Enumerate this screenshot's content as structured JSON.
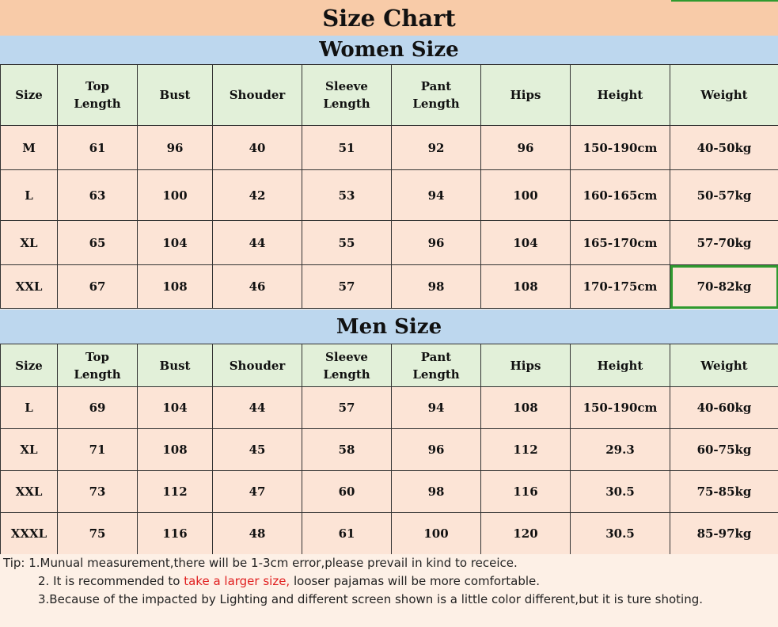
{
  "title": "Size Chart",
  "women": {
    "heading": "Women Size",
    "headers": [
      "Size",
      "Top\nLength",
      "Bust",
      "Shouder",
      "Sleeve\nLength",
      "Pant\nLength",
      "Hips",
      "Height",
      "Weight"
    ],
    "rows": [
      [
        "M",
        "61",
        "96",
        "40",
        "51",
        "92",
        "96",
        "150-190cm",
        "40-50kg"
      ],
      [
        "L",
        "63",
        "100",
        "42",
        "53",
        "94",
        "100",
        "160-165cm",
        "50-57kg"
      ],
      [
        "XL",
        "65",
        "104",
        "44",
        "55",
        "96",
        "104",
        "165-170cm",
        "57-70kg"
      ],
      [
        "XXL",
        "67",
        "108",
        "46",
        "57",
        "98",
        "108",
        "170-175cm",
        "70-82kg"
      ]
    ]
  },
  "men": {
    "heading": "Men Size",
    "headers": [
      "Size",
      "Top\nLength",
      "Bust",
      "Shouder",
      "Sleeve\nLength",
      "Pant\nLength",
      "Hips",
      "Height",
      "Weight"
    ],
    "rows": [
      [
        "L",
        "69",
        "104",
        "44",
        "57",
        "94",
        "108",
        "150-190cm",
        "40-60kg"
      ],
      [
        "XL",
        "71",
        "108",
        "45",
        "58",
        "96",
        "112",
        "29.3",
        "60-75kg"
      ],
      [
        "XXL",
        "73",
        "112",
        "47",
        "60",
        "98",
        "116",
        "30.5",
        "75-85kg"
      ],
      [
        "XXXL",
        "75",
        "116",
        "48",
        "61",
        "100",
        "120",
        "30.5",
        "85-97kg"
      ]
    ]
  },
  "tips": {
    "line1": "Tip:  1.Munual measurement,there will be 1-3cm error,please prevail in kind to receice.",
    "line2_before": "2. It is recommended to ",
    "line2_highlight": "take a larger size,",
    "line2_after": " looser pajamas will be more comfortable.",
    "line3": "3.Because of the impacted by Lighting and different screen shown is a little color different,but it is ture shoting.",
    "highlight_color": "#e02020"
  }
}
